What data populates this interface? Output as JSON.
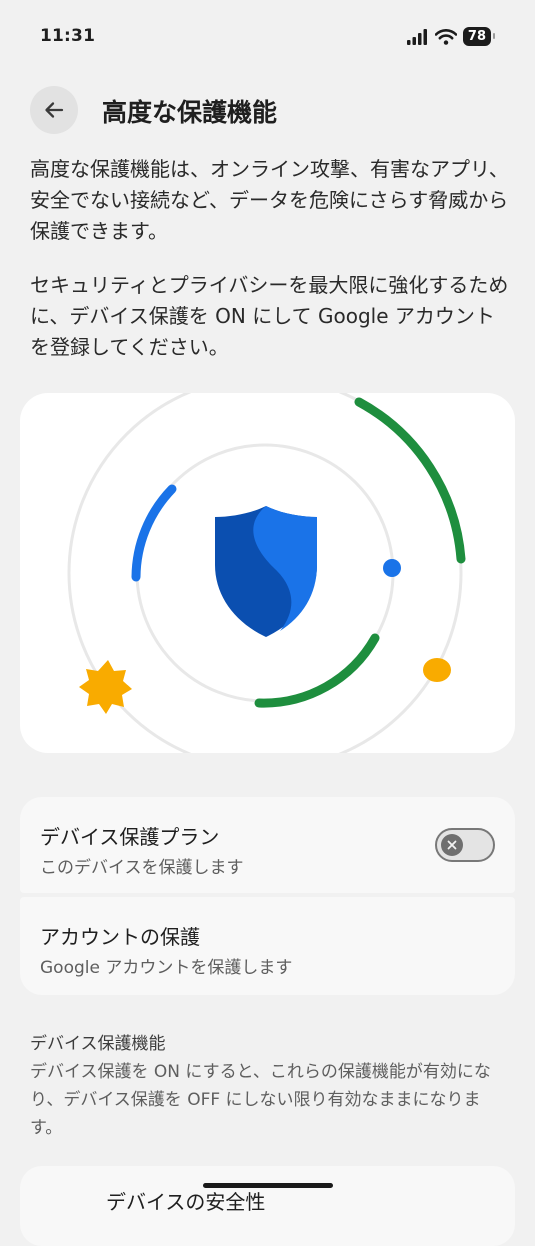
{
  "status_bar": {
    "time": "11:31",
    "battery": "78"
  },
  "header": {
    "title": "高度な保護機能"
  },
  "intro": {
    "paragraph1": "高度な保護機能は、オンライン攻撃、有害なアプリ、安全でない接続など、データを危険にさらす脅威から保護できます。",
    "paragraph2": " セキュリティとプライバシーを最大限に強化するために、デバイス保護を ON にして Google アカウントを登録してください。"
  },
  "options": [
    {
      "title": "デバイス保護プラン",
      "subtitle": "このデバイスを保護します",
      "toggle": "off"
    },
    {
      "title": "アカウントの保護",
      "subtitle": "Google アカウントを保護します"
    }
  ],
  "section": {
    "title": "デバイス保護機能",
    "description": "デバイス保護を ON にすると、これらの保護機能が有効になり、デバイス保護を OFF にしない限り有効なままになります。"
  },
  "partial_item": {
    "title": "デバイスの安全性"
  },
  "colors": {
    "shield_dark": "#0b4fb0",
    "shield_light": "#1a73e8",
    "green": "#1e8e3e",
    "blue": "#1a73e8",
    "yellow": "#f9ab00"
  }
}
